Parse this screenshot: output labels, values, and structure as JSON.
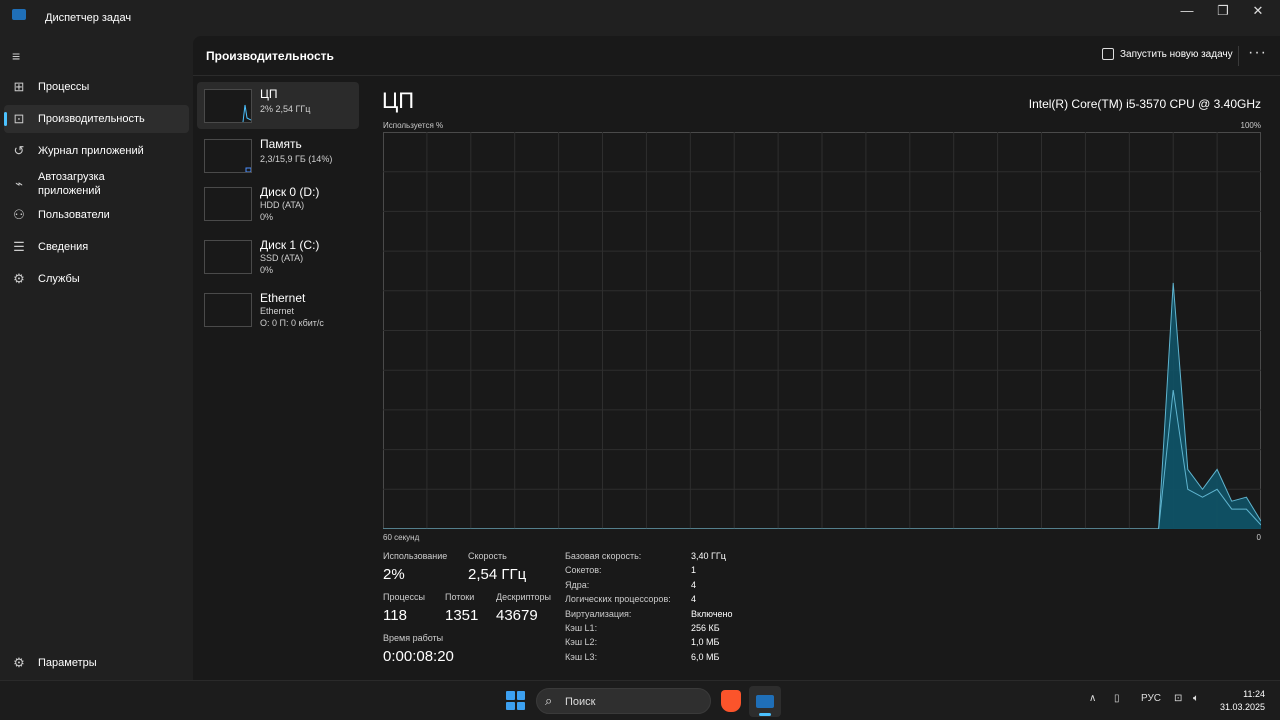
{
  "window": {
    "title": "Диспетчер задач",
    "controls": [
      "minimize-icon",
      "maximize-icon",
      "close-icon"
    ]
  },
  "sidebar": {
    "items": [
      {
        "label": "Процессы",
        "icon": "processes-icon"
      },
      {
        "label": "Производительность",
        "icon": "performance-icon",
        "active": true
      },
      {
        "label": "Журнал приложений",
        "icon": "history-icon"
      },
      {
        "label": "Автозагрузка приложений",
        "icon": "startup-icon"
      },
      {
        "label": "Пользователи",
        "icon": "users-icon"
      },
      {
        "label": "Сведения",
        "icon": "details-icon"
      },
      {
        "label": "Службы",
        "icon": "services-icon"
      }
    ],
    "settings_label": "Параметры"
  },
  "header": {
    "title": "Производительность",
    "run_task_label": "Запустить новую задачу",
    "more_label": "···"
  },
  "devices": [
    {
      "name": "ЦП",
      "line1": "2% 2,54 ГГц",
      "line2": "",
      "active": true
    },
    {
      "name": "Память",
      "line1": "2,3/15,9 ГБ (14%)",
      "line2": ""
    },
    {
      "name": "Диск 0 (D:)",
      "line1": "HDD (ATA)",
      "line2": "0%"
    },
    {
      "name": "Диск 1 (C:)",
      "line1": "SSD (ATA)",
      "line2": "0%"
    },
    {
      "name": "Ethernet",
      "line1": "Ethernet",
      "line2": "О: 0 П: 0 кбит/с"
    }
  ],
  "detail": {
    "title": "ЦП",
    "model": "Intel(R) Core(TM) i5-3570 CPU @ 3.40GHz",
    "chart_ylabel": "Используется %",
    "chart_ymax_label": "100%",
    "chart_xlabel": "60 секунд",
    "chart_xmin_label": "0"
  },
  "chart_data": {
    "type": "area",
    "xlabel": "60 секунд",
    "ylabel": "Используется %",
    "xlim": [
      60,
      0
    ],
    "ylim": [
      0,
      100
    ],
    "grid": true,
    "x": [
      60,
      7,
      6,
      5,
      4,
      3,
      2,
      1,
      0
    ],
    "series": [
      {
        "values": [
          0,
          0,
          62,
          15,
          10,
          15,
          7,
          8,
          2
        ]
      },
      {
        "values": [
          0,
          0,
          35,
          10,
          8,
          10,
          5,
          5,
          1
        ]
      }
    ],
    "colors": {
      "line": "#5fb4cf",
      "fill": "#0f5266",
      "grid": "#2e2e2e",
      "border": "#4a4a4a"
    }
  },
  "stats": {
    "usage_label": "Использование",
    "usage_value": "2%",
    "speed_label": "Скорость",
    "speed_value": "2,54 ГГц",
    "processes_label": "Процессы",
    "processes_value": "118",
    "threads_label": "Потоки",
    "threads_value": "1351",
    "handles_label": "Дескрипторы",
    "handles_value": "43679",
    "uptime_label": "Время работы",
    "uptime_value": "0:00:08:20"
  },
  "info": [
    {
      "label": "Базовая скорость:",
      "value": "3,40 ГГц"
    },
    {
      "label": "Сокетов:",
      "value": "1"
    },
    {
      "label": "Ядра:",
      "value": "4"
    },
    {
      "label": "Логических процессоров:",
      "value": "4"
    },
    {
      "label": "Виртуализация:",
      "value": "Включено"
    },
    {
      "label": "Кэш L1:",
      "value": "256 КБ"
    },
    {
      "label": "Кэш L2:",
      "value": "1,0 МБ"
    },
    {
      "label": "Кэш L3:",
      "value": "6,0 МБ"
    }
  ],
  "taskbar": {
    "search_placeholder": "Поиск",
    "language": "РУС",
    "time": "11:24",
    "date": "31.03.2025"
  }
}
